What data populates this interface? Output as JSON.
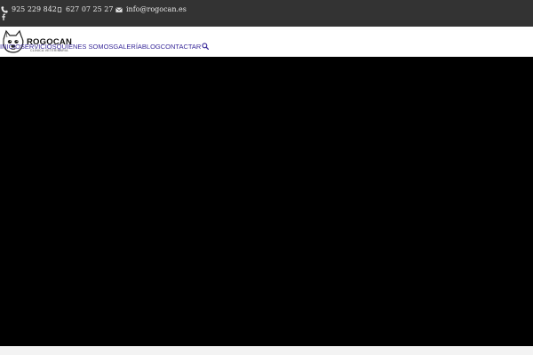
{
  "topbar": {
    "phone1": "925 229 842",
    "phone2": "627 07 25 27",
    "email": "info@rogocan.es",
    "phone_icon": "phone-icon",
    "mobile_icon": "mobile-icon",
    "email_icon": "envelope-icon",
    "social_icon": "facebook-icon"
  },
  "logo": {
    "brand": "ROGOCAN",
    "tagline": "CLÍNICA VETERINARIA"
  },
  "nav": {
    "items": [
      "INICIO",
      "SERVICIOS",
      "QUIENES SOMOS",
      "GALERÍA",
      "BLOG",
      "CONTACTAR"
    ],
    "search_icon": "search-icon"
  },
  "colors": {
    "topbar_bg": "#333333",
    "nav_text": "#3a2a9a",
    "hero_bg": "#000000"
  }
}
